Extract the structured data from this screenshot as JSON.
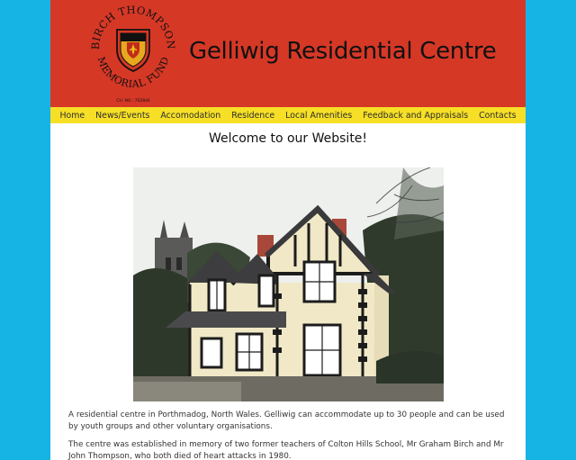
{
  "header": {
    "logo": {
      "top_text": "BIRCH THOMPSON",
      "bottom_text": "MEMORIAL FUND",
      "charity_no": "CH. NO.: 702844"
    },
    "site_title": "Gelliwig Residential Centre"
  },
  "nav": {
    "items": [
      {
        "label": "Home"
      },
      {
        "label": "News/Events"
      },
      {
        "label": "Accomodation"
      },
      {
        "label": "Residence"
      },
      {
        "label": "Local Amenities"
      },
      {
        "label": "Feedback and Appraisals"
      },
      {
        "label": "Contacts"
      }
    ]
  },
  "main": {
    "heading": "Welcome to our Website!",
    "paragraphs": [
      "A residential centre in Porthmadog, North Wales. Gelliwig can accommodate up to 30 people and can be used by youth groups and other voluntary organisations.",
      "The centre was established in memory of two former teachers of Colton Hills School, Mr Graham Birch and Mr John Thompson, who both died of heart attacks in 1980."
    ]
  },
  "colors": {
    "background": "#16b4e4",
    "header": "#d63826",
    "nav": "#f6df26",
    "content": "#ffffff"
  }
}
